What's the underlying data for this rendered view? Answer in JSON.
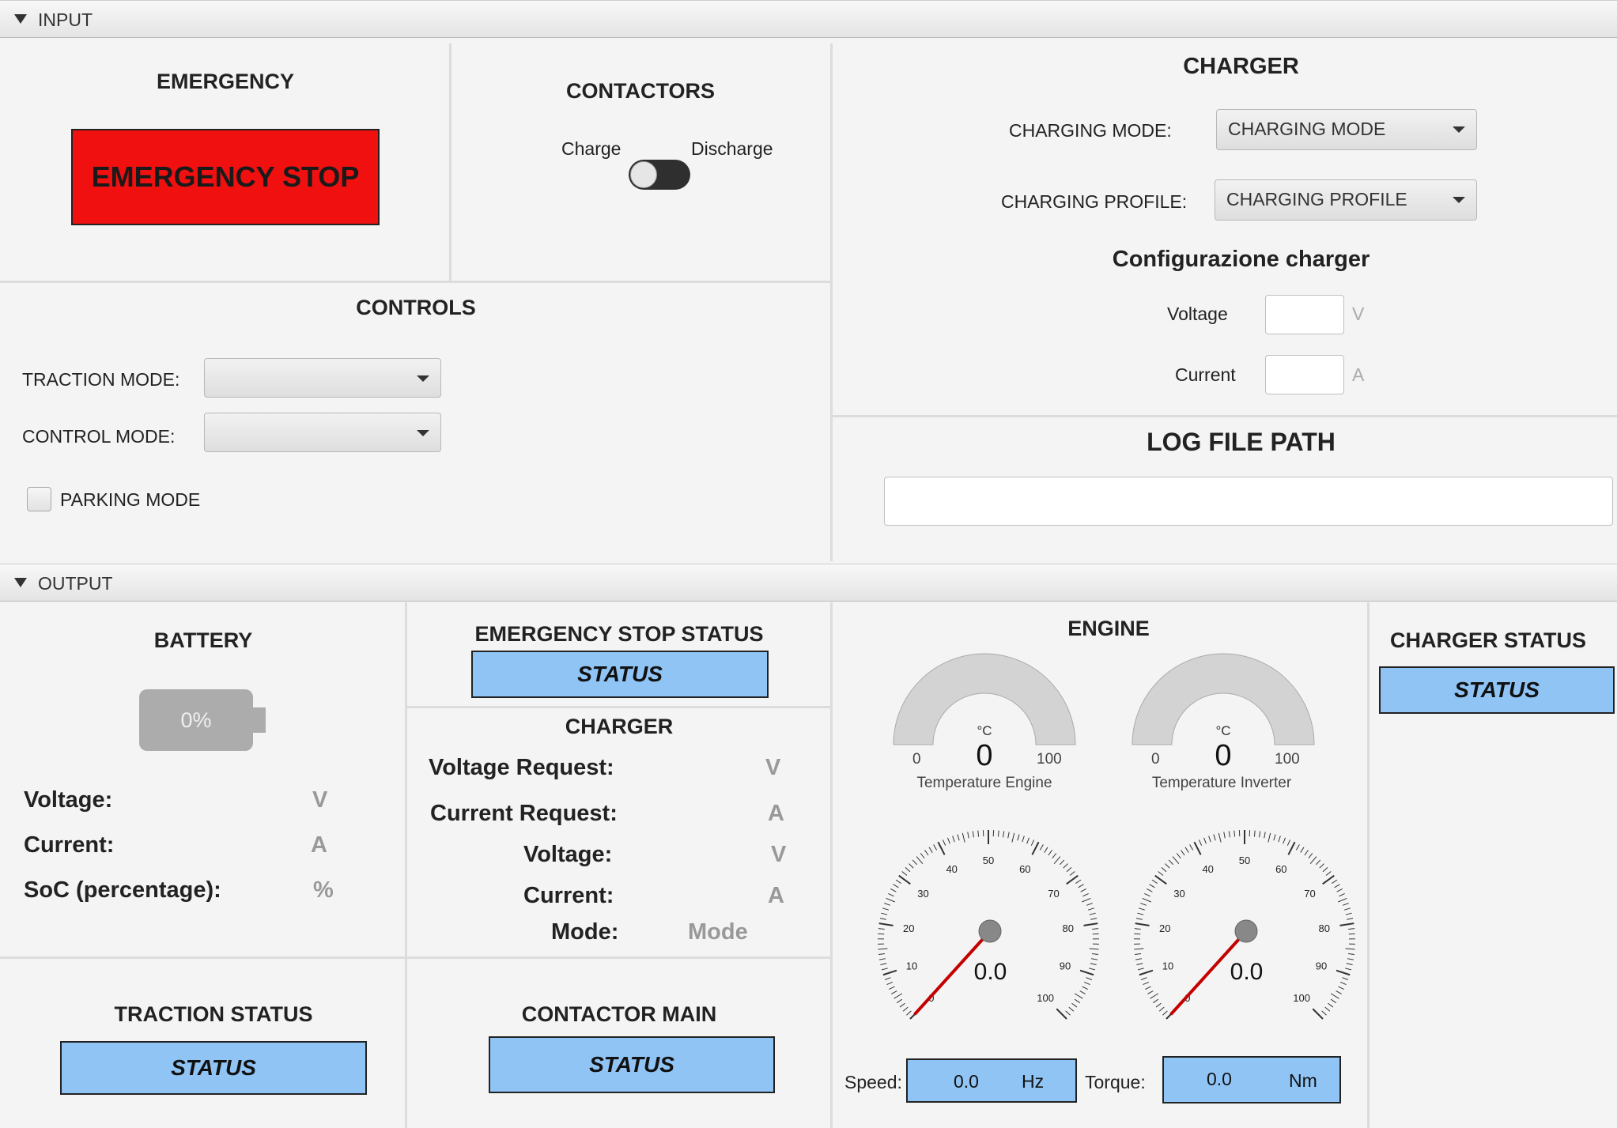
{
  "input": {
    "section_label": "INPUT",
    "emergency": {
      "title": "EMERGENCY",
      "button_label": "EMERGENCY STOP",
      "button_color": "#f01010"
    },
    "contactors": {
      "title": "CONTACTORS",
      "left_label": "Charge",
      "right_label": "Discharge"
    },
    "controls": {
      "title": "CONTROLS",
      "traction_mode_label": "TRACTION MODE:",
      "traction_mode_value": "",
      "control_mode_label": "CONTROL MODE:",
      "control_mode_value": "",
      "parking_label": "PARKING MODE"
    },
    "charger": {
      "title": "CHARGER",
      "charging_mode_label": "CHARGING MODE:",
      "charging_mode_value": "CHARGING MODE",
      "charging_profile_label": "CHARGING PROFILE:",
      "charging_profile_value": "CHARGING PROFILE",
      "config_title": "Configurazione charger",
      "voltage_label": "Voltage",
      "voltage_value": "",
      "voltage_unit": "V",
      "current_label": "Current",
      "current_value": "",
      "current_unit": "A"
    },
    "log": {
      "title": "LOG FILE PATH",
      "value": ""
    }
  },
  "output": {
    "section_label": "OUTPUT",
    "battery": {
      "title": "BATTERY",
      "level_text": "0%",
      "level": 0,
      "voltage_label": "Voltage:",
      "voltage_unit": "V",
      "current_label": "Current:",
      "current_unit": "A",
      "soc_label": "SoC (percentage):",
      "soc_unit": "%"
    },
    "emergency_status": {
      "title": "EMERGENCY STOP STATUS",
      "status": "STATUS"
    },
    "charger": {
      "title": "CHARGER",
      "voltage_request_label": "Voltage Request:",
      "voltage_request_unit": "V",
      "current_request_label": "Current Request:",
      "current_request_unit": "A",
      "voltage_label": "Voltage:",
      "voltage_unit": "V",
      "current_label": "Current:",
      "current_unit": "A",
      "mode_label": "Mode:",
      "mode_value": "Mode"
    },
    "engine": {
      "title": "ENGINE",
      "temp_engine": {
        "unit": "°C",
        "value": "0",
        "min": "0",
        "max": "100",
        "label": "Temperature Engine"
      },
      "temp_inverter": {
        "unit": "°C",
        "value": "0",
        "min": "0",
        "max": "100",
        "label": "Temperature Inverter"
      },
      "gauge_ticks": [
        "0",
        "10",
        "20",
        "30",
        "40",
        "50",
        "60",
        "70",
        "80",
        "90",
        "100"
      ],
      "speed_gauge_value": "0.0",
      "torque_gauge_value": "0.0",
      "speed_label": "Speed:",
      "speed_value": "0.0",
      "speed_unit": "Hz",
      "torque_label": "Torque:",
      "torque_value": "0.0",
      "torque_unit": "Nm"
    },
    "charger_status": {
      "title": "CHARGER STATUS",
      "status": "STATUS"
    },
    "traction_status": {
      "title": "TRACTION STATUS",
      "status": "STATUS"
    },
    "contactor_main": {
      "title": "CONTACTOR MAIN",
      "status": "STATUS"
    },
    "status_color": "#8fc4f5"
  }
}
